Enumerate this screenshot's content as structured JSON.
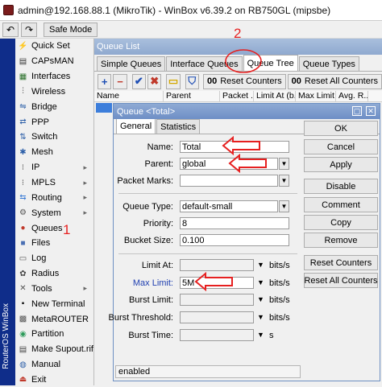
{
  "window": {
    "title": "admin@192.168.88.1 (MikroTik) - WinBox v6.39.2 on RB750GL (mipsbe)"
  },
  "toolbar": {
    "undo": "↶",
    "redo": "↷",
    "safe_mode": "Safe Mode"
  },
  "sidebar": {
    "vertical_text": "RouterOS WinBox"
  },
  "menu": {
    "items": [
      {
        "label": "Quick Set",
        "icon": "⚡",
        "color": "#c0392b"
      },
      {
        "label": "CAPsMAN",
        "icon": "▤",
        "color": "#333"
      },
      {
        "label": "Interfaces",
        "icon": "▦",
        "color": "#2a6f2a"
      },
      {
        "label": "Wireless",
        "icon": "⫶",
        "color": "#333"
      },
      {
        "label": "Bridge",
        "icon": "⇋",
        "color": "#2d5fa8"
      },
      {
        "label": "PPP",
        "icon": "⇄",
        "color": "#2d5fa8"
      },
      {
        "label": "Switch",
        "icon": "⇅",
        "color": "#2d5fa8"
      },
      {
        "label": "Mesh",
        "icon": "✱",
        "color": "#2d5fa8"
      },
      {
        "label": "IP",
        "icon": "⁝",
        "color": "#444",
        "arrow": "▸"
      },
      {
        "label": "MPLS",
        "icon": "⁝",
        "color": "#444",
        "arrow": "▸"
      },
      {
        "label": "Routing",
        "icon": "⇆",
        "color": "#3a7bd5",
        "arrow": "▸"
      },
      {
        "label": "System",
        "icon": "⚙",
        "color": "#555",
        "arrow": "▸"
      },
      {
        "label": "Queues",
        "icon": "●",
        "color": "#c0392b"
      },
      {
        "label": "Files",
        "icon": "■",
        "color": "#4a6fb3"
      },
      {
        "label": "Log",
        "icon": "▭",
        "color": "#555"
      },
      {
        "label": "Radius",
        "icon": "✿",
        "color": "#444"
      },
      {
        "label": "Tools",
        "icon": "✕",
        "color": "#555",
        "arrow": "▸"
      },
      {
        "label": "New Terminal",
        "icon": "▪",
        "color": "#111"
      },
      {
        "label": "MetaROUTER",
        "icon": "▩",
        "color": "#555"
      },
      {
        "label": "Partition",
        "icon": "◉",
        "color": "#2d9b5a"
      },
      {
        "label": "Make Supout.rif",
        "icon": "▤",
        "color": "#444"
      },
      {
        "label": "Manual",
        "icon": "◍",
        "color": "#2d5fa8"
      },
      {
        "label": "Exit",
        "icon": "⏏",
        "color": "#c0392b"
      }
    ]
  },
  "annotations": {
    "one": "1",
    "two": "2"
  },
  "queue_list": {
    "title": "Queue List",
    "tabs": [
      "Simple Queues",
      "Interface Queues",
      "Queue Tree",
      "Queue Types"
    ],
    "tool_buttons": [
      "+",
      "−",
      "✔",
      "✖",
      "▭",
      "⛉"
    ],
    "reset_counters": "Reset Counters",
    "reset_all_counters": "Reset All Counters",
    "counter_prefix": "00",
    "columns": [
      "Name",
      "Parent",
      "Packet ...",
      "Limit At (b...",
      "Max Limit ...",
      "Avg. R..."
    ]
  },
  "dialog": {
    "title": "Queue <Total>",
    "tabs": [
      "General",
      "Statistics"
    ],
    "fields": {
      "name": {
        "label": "Name:",
        "value": "Total"
      },
      "parent": {
        "label": "Parent:",
        "value": "global"
      },
      "packet_marks": {
        "label": "Packet Marks:",
        "value": ""
      },
      "queue_type": {
        "label": "Queue Type:",
        "value": "default-small"
      },
      "priority": {
        "label": "Priority:",
        "value": "8"
      },
      "bucket_size": {
        "label": "Bucket Size:",
        "value": "0.100"
      },
      "limit_at": {
        "label": "Limit At:",
        "value": "",
        "unit": "bits/s"
      },
      "max_limit": {
        "label": "Max Limit:",
        "value": "5M",
        "unit": "bits/s"
      },
      "burst_limit": {
        "label": "Burst Limit:",
        "value": "",
        "unit": "bits/s"
      },
      "burst_threshold": {
        "label": "Burst Threshold:",
        "value": "",
        "unit": "bits/s"
      },
      "burst_time": {
        "label": "Burst Time:",
        "value": "",
        "unit": "s"
      }
    },
    "buttons": [
      "OK",
      "Cancel",
      "Apply",
      "Disable",
      "Comment",
      "Copy",
      "Remove",
      "Reset Counters",
      "Reset All Counters"
    ],
    "status": "enabled"
  },
  "colors": {
    "accent": "#e62020",
    "sidebar": "#0f2d8a",
    "selection": "#3d7edb"
  }
}
